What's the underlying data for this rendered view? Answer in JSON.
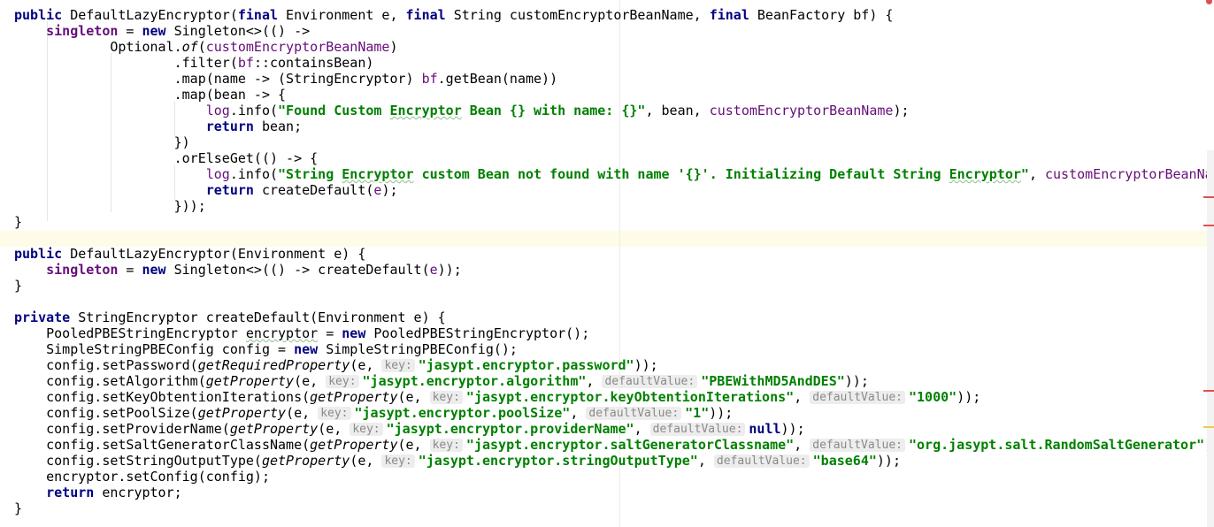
{
  "editor": {
    "lines": [
      {
        "segs": [
          {
            "t": "public",
            "c": "kw"
          },
          {
            "t": " DefaultLazyEncryptor("
          },
          {
            "t": "final",
            "c": "kw"
          },
          {
            "t": " Environment e, "
          },
          {
            "t": "final",
            "c": "kw"
          },
          {
            "t": " String customEncryptorBeanName, "
          },
          {
            "t": "final",
            "c": "kw"
          },
          {
            "t": " BeanFactory bf) {"
          }
        ]
      },
      {
        "segs": [
          {
            "t": "    "
          },
          {
            "t": "singleton",
            "c": "fld"
          },
          {
            "t": " = "
          },
          {
            "t": "new",
            "c": "kw"
          },
          {
            "t": " Singleton<>(() ->"
          }
        ]
      },
      {
        "segs": [
          {
            "t": "            Optional."
          },
          {
            "t": "of",
            "c": "it"
          },
          {
            "t": "("
          },
          {
            "t": "customEncryptorBeanName",
            "c": "param"
          },
          {
            "t": ")"
          }
        ]
      },
      {
        "segs": [
          {
            "t": "                    .filter("
          },
          {
            "t": "bf",
            "c": "param"
          },
          {
            "t": "::containsBean)"
          }
        ]
      },
      {
        "segs": [
          {
            "t": "                    .map(name -> (StringEncryptor) "
          },
          {
            "t": "bf",
            "c": "param"
          },
          {
            "t": ".getBean(name))"
          }
        ]
      },
      {
        "segs": [
          {
            "t": "                    .map(bean -> {"
          }
        ]
      },
      {
        "segs": [
          {
            "t": "                        "
          },
          {
            "t": "log",
            "c": "param"
          },
          {
            "t": ".info("
          },
          {
            "t": "\"Found Custom ",
            "c": "st"
          },
          {
            "t": "Encryptor",
            "c": "st uline"
          },
          {
            "t": " Bean {} with name: {}\"",
            "c": "st"
          },
          {
            "t": ", bean, "
          },
          {
            "t": "customEncryptorBeanName",
            "c": "param"
          },
          {
            "t": ");"
          }
        ]
      },
      {
        "segs": [
          {
            "t": "                        "
          },
          {
            "t": "return",
            "c": "kw"
          },
          {
            "t": " bean;"
          }
        ]
      },
      {
        "segs": [
          {
            "t": "                    })"
          }
        ]
      },
      {
        "segs": [
          {
            "t": "                    .orElseGet(() -> {"
          }
        ]
      },
      {
        "segs": [
          {
            "t": "                        "
          },
          {
            "t": "log",
            "c": "param"
          },
          {
            "t": ".info("
          },
          {
            "t": "\"String ",
            "c": "st"
          },
          {
            "t": "Encryptor",
            "c": "st uline"
          },
          {
            "t": " custom Bean not found with name '{}'. Initializing Default String ",
            "c": "st"
          },
          {
            "t": "Encryptor",
            "c": "st uline"
          },
          {
            "t": "\"",
            "c": "st"
          },
          {
            "t": ", "
          },
          {
            "t": "customEncryptorBeanName",
            "c": "param"
          }
        ]
      },
      {
        "segs": [
          {
            "t": "                        "
          },
          {
            "t": "return",
            "c": "kw"
          },
          {
            "t": " createDefault("
          },
          {
            "t": "e",
            "c": "param"
          },
          {
            "t": ");"
          }
        ]
      },
      {
        "segs": [
          {
            "t": "                    }));"
          }
        ]
      },
      {
        "segs": [
          {
            "t": "}"
          }
        ]
      },
      {
        "segs": []
      },
      {
        "segs": [
          {
            "t": "public",
            "c": "kw"
          },
          {
            "t": " DefaultLazyEncryptor(Environment e) {"
          }
        ]
      },
      {
        "segs": [
          {
            "t": "    "
          },
          {
            "t": "singleton",
            "c": "fld"
          },
          {
            "t": " = "
          },
          {
            "t": "new",
            "c": "kw"
          },
          {
            "t": " Singleton<>(() -> createDefault("
          },
          {
            "t": "e",
            "c": "param"
          },
          {
            "t": "));"
          }
        ]
      },
      {
        "segs": [
          {
            "t": "}"
          }
        ]
      },
      {
        "segs": []
      },
      {
        "segs": [
          {
            "t": "private",
            "c": "kw"
          },
          {
            "t": " StringEncryptor createDefault(Environment e) {"
          }
        ]
      },
      {
        "segs": [
          {
            "t": "    PooledPBEStringEncryptor "
          },
          {
            "t": "encryptor",
            "c": "uline"
          },
          {
            "t": " = "
          },
          {
            "t": "new",
            "c": "kw"
          },
          {
            "t": " PooledPBEStringEncryptor();"
          }
        ]
      },
      {
        "segs": [
          {
            "t": "    SimpleStringPBEConfig config = "
          },
          {
            "t": "new",
            "c": "kw"
          },
          {
            "t": " SimpleStringPBEConfig();"
          }
        ]
      },
      {
        "segs": [
          {
            "t": "    config.setPassword("
          },
          {
            "t": "getRequiredProperty",
            "c": "it"
          },
          {
            "t": "(e, "
          },
          {
            "t": "key:",
            "c": "hint"
          },
          {
            "t": "\"jasypt.encryptor.password\"",
            "c": "st"
          },
          {
            "t": "));"
          }
        ]
      },
      {
        "segs": [
          {
            "t": "    config.setAlgorithm("
          },
          {
            "t": "getProperty",
            "c": "it"
          },
          {
            "t": "(e, "
          },
          {
            "t": "key:",
            "c": "hint"
          },
          {
            "t": "\"jasypt.encryptor.algorithm\"",
            "c": "st"
          },
          {
            "t": ", "
          },
          {
            "t": "defaultValue:",
            "c": "hint"
          },
          {
            "t": "\"PBEWithMD5AndDES\"",
            "c": "st"
          },
          {
            "t": "));"
          }
        ]
      },
      {
        "segs": [
          {
            "t": "    config.setKeyObtentionIterations("
          },
          {
            "t": "getProperty",
            "c": "it"
          },
          {
            "t": "(e, "
          },
          {
            "t": "key:",
            "c": "hint"
          },
          {
            "t": "\"jasypt.encryptor.keyObtentionIterations\"",
            "c": "st"
          },
          {
            "t": ", "
          },
          {
            "t": "defaultValue:",
            "c": "hint"
          },
          {
            "t": "\"1000\"",
            "c": "st"
          },
          {
            "t": "));"
          }
        ]
      },
      {
        "segs": [
          {
            "t": "    config.setPoolSize("
          },
          {
            "t": "getProperty",
            "c": "it"
          },
          {
            "t": "(e, "
          },
          {
            "t": "key:",
            "c": "hint"
          },
          {
            "t": "\"jasypt.encryptor.poolSize\"",
            "c": "st"
          },
          {
            "t": ", "
          },
          {
            "t": "defaultValue:",
            "c": "hint"
          },
          {
            "t": "\"1\"",
            "c": "st"
          },
          {
            "t": "));"
          }
        ]
      },
      {
        "segs": [
          {
            "t": "    config.setProviderName("
          },
          {
            "t": "getProperty",
            "c": "it"
          },
          {
            "t": "(e, "
          },
          {
            "t": "key:",
            "c": "hint"
          },
          {
            "t": "\"jasypt.encryptor.providerName\"",
            "c": "st"
          },
          {
            "t": ", "
          },
          {
            "t": "defaultValue:",
            "c": "hint"
          },
          {
            "t": "null",
            "c": "kw"
          },
          {
            "t": "));"
          }
        ]
      },
      {
        "segs": [
          {
            "t": "    config.setSaltGeneratorClassName("
          },
          {
            "t": "getProperty",
            "c": "it"
          },
          {
            "t": "(e, "
          },
          {
            "t": "key:",
            "c": "hint"
          },
          {
            "t": "\"jasypt.encryptor.saltGeneratorClassname\"",
            "c": "st"
          },
          {
            "t": ", "
          },
          {
            "t": "defaultValue:",
            "c": "hint"
          },
          {
            "t": "\"org.jasypt.salt.RandomSaltGenerator\"",
            "c": "st"
          },
          {
            "t": "));"
          }
        ]
      },
      {
        "segs": [
          {
            "t": "    config.setStringOutputType("
          },
          {
            "t": "getProperty",
            "c": "it"
          },
          {
            "t": "(e, "
          },
          {
            "t": "key:",
            "c": "hint"
          },
          {
            "t": "\"jasypt.encryptor.stringOutputType\"",
            "c": "st"
          },
          {
            "t": ", "
          },
          {
            "t": "defaultValue:",
            "c": "hint"
          },
          {
            "t": "\"base64\"",
            "c": "st"
          },
          {
            "t": "));"
          }
        ]
      },
      {
        "segs": [
          {
            "t": "    encryptor.setConfig(config);"
          }
        ]
      },
      {
        "segs": [
          {
            "t": "    "
          },
          {
            "t": "return",
            "c": "kw"
          },
          {
            "t": " encryptor;"
          }
        ]
      },
      {
        "segs": [
          {
            "t": "}"
          }
        ]
      }
    ],
    "current_line": 14,
    "colors": {
      "keyword": "#000080",
      "field": "#660e7a",
      "string": "#008000",
      "hint_bg": "#ededed",
      "caret_line": "#fefbe8",
      "error_mark": "#e05050",
      "warning_mark": "#f2c94c"
    },
    "scroll_marks": [
      "error",
      "error",
      "error",
      "warning"
    ]
  }
}
